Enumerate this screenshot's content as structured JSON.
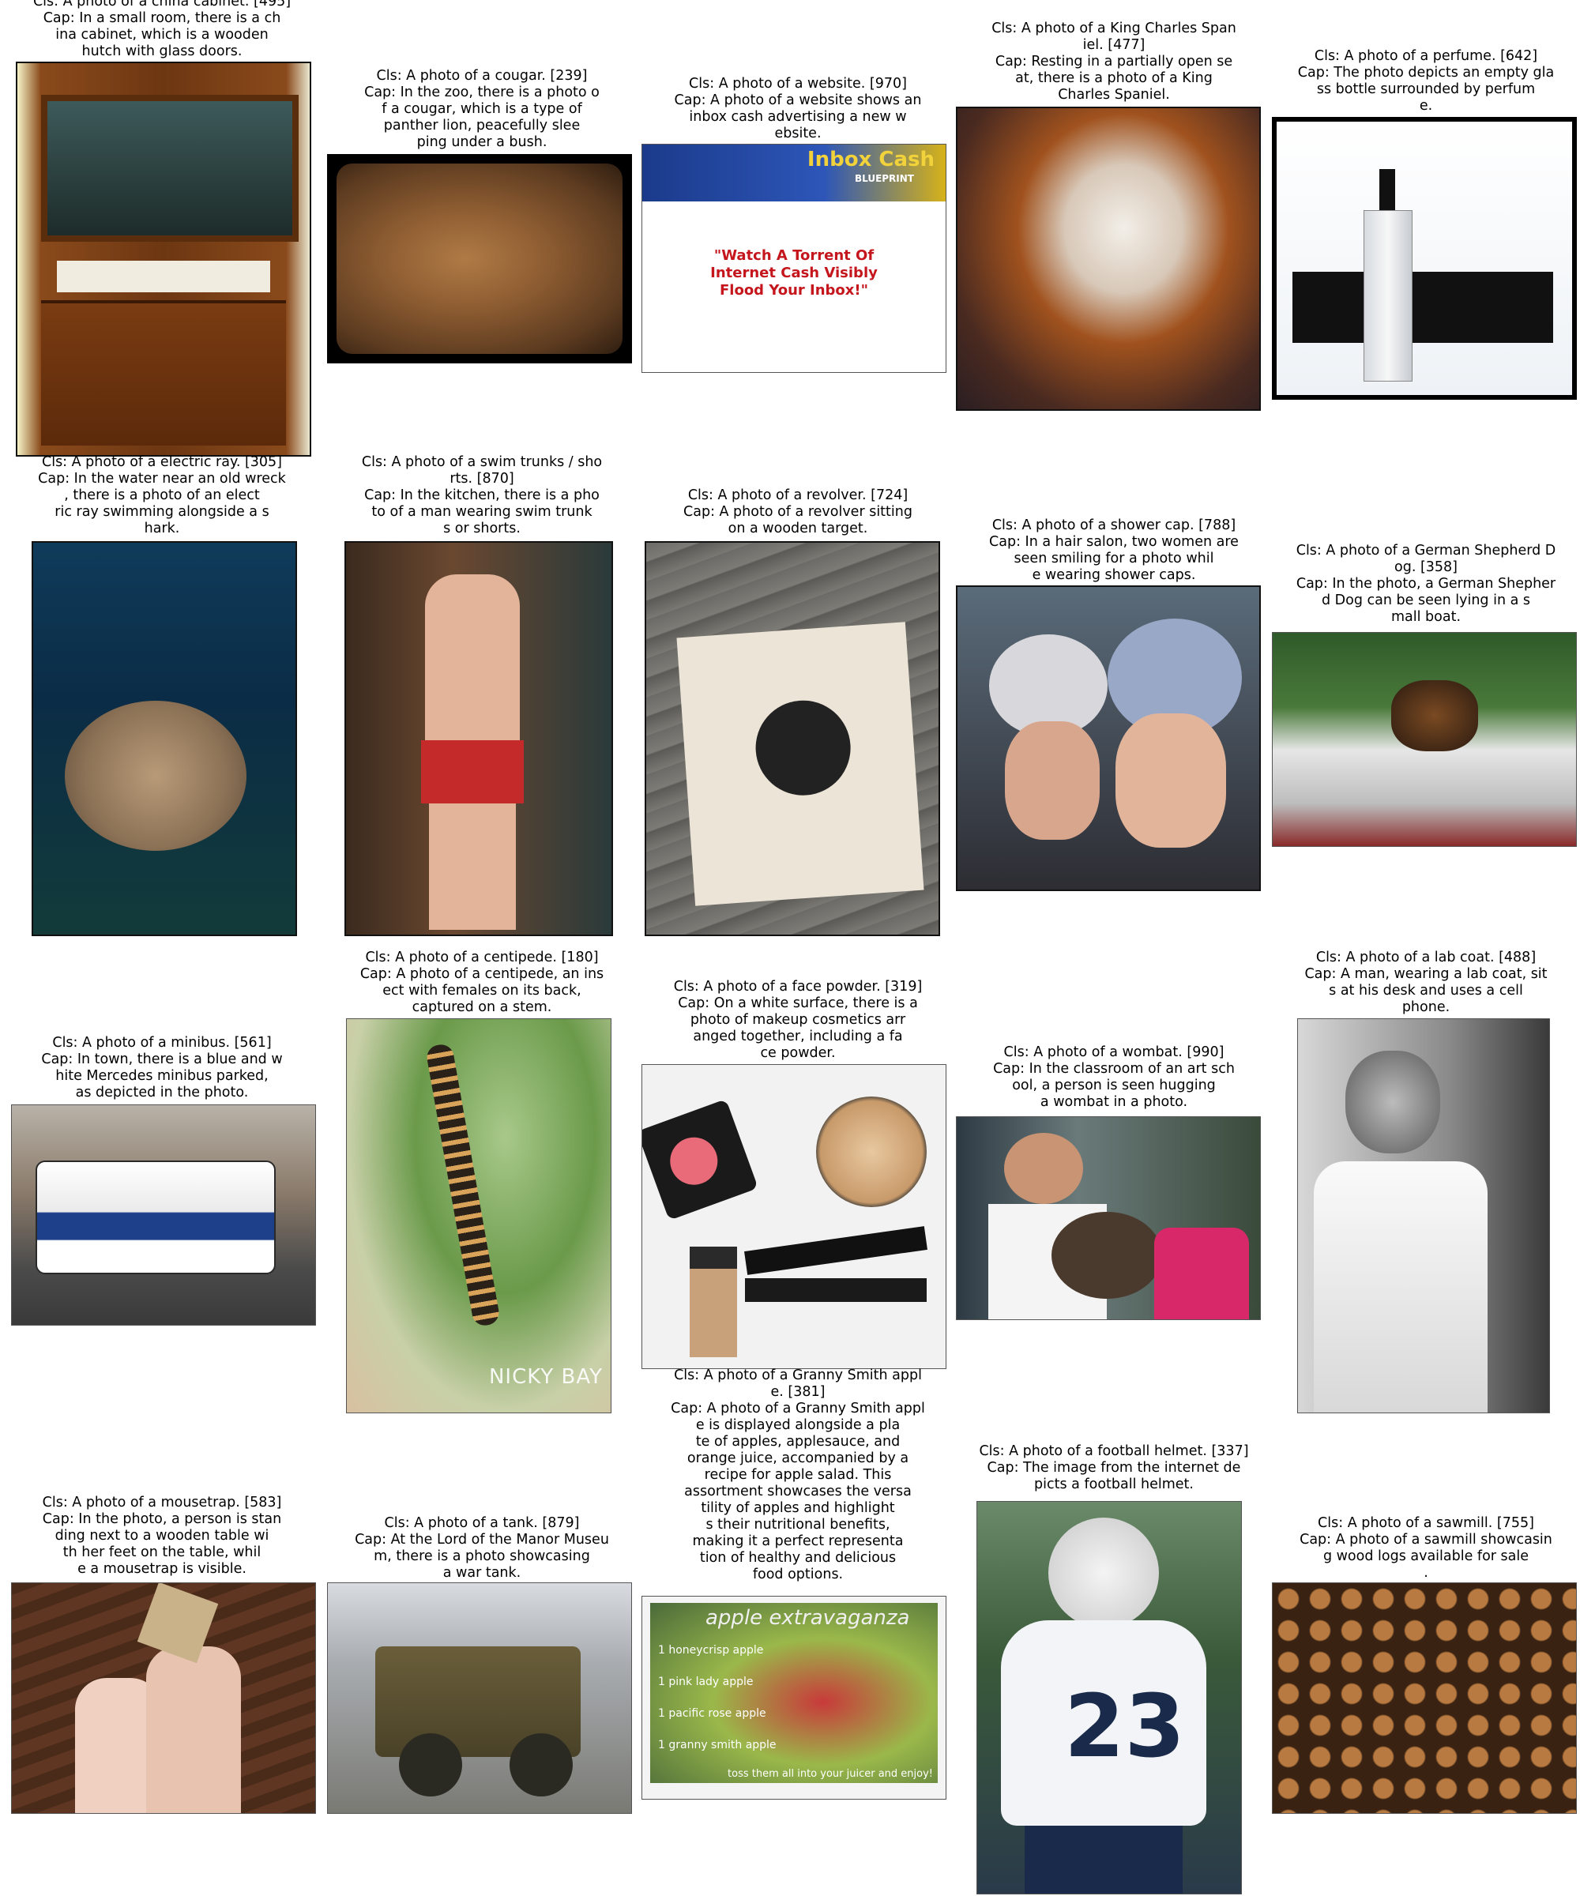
{
  "cells": [
    {
      "lines": [
        "Cls: A photo of a china cabinet. [495]",
        "Cap: In a small room, there is a ch",
        "ina cabinet, which is a wooden",
        "hutch with glass doors."
      ]
    },
    {
      "lines": [
        "Cls: A photo of a cougar. [239]",
        "Cap: In the zoo, there is a photo o",
        "f a cougar, which is a type of",
        "panther lion, peacefully slee",
        "ping under a bush."
      ]
    },
    {
      "lines": [
        "Cls: A photo of a website. [970]",
        "Cap: A photo of a website shows an",
        "inbox cash advertising a new w",
        "ebsite."
      ],
      "inner": {
        "banner": "Inbox Cash",
        "banner_sub": "BLUEPRINT",
        "headline": "\"Watch A Torrent Of Internet Cash Visibly Flood Your Inbox!\""
      }
    },
    {
      "lines": [
        "Cls: A photo of a King Charles Span",
        "iel. [477]",
        "Cap: Resting in a partially open se",
        "at, there is a photo of a King",
        "Charles Spaniel."
      ]
    },
    {
      "lines": [
        "Cls: A photo of a perfume. [642]",
        "Cap: The photo depicts an empty gla",
        "ss bottle surrounded by perfum",
        "e."
      ]
    },
    {
      "lines": [
        "Cls: A photo of a electric ray. [305]",
        "Cap: In the water near an old wreck",
        ", there is a photo of an elect",
        "ric ray swimming alongside a s",
        "hark."
      ]
    },
    {
      "lines": [
        "Cls: A photo of a swim trunks / sho",
        "rts. [870]",
        "Cap: In the kitchen, there is a pho",
        "to of a man wearing swim trunk",
        "s or shorts."
      ]
    },
    {
      "lines": [
        "Cls: A photo of a revolver. [724]",
        "Cap: A photo of a revolver sitting",
        "on a wooden target."
      ]
    },
    {
      "lines": [
        "Cls: A photo of a shower cap. [788]",
        "Cap: In a hair salon, two women are",
        "seen smiling for a photo whil",
        "e wearing shower caps."
      ]
    },
    {
      "lines": [
        "Cls: A photo of a German Shepherd D",
        "og. [358]",
        "Cap: In the photo, a German Shepher",
        "d Dog can be seen lying in a s",
        "mall boat."
      ]
    },
    {
      "lines": [
        "Cls: A photo of a minibus. [561]",
        "Cap: In town, there is a blue and w",
        "hite Mercedes minibus parked,",
        "as depicted in the photo."
      ]
    },
    {
      "lines": [
        "Cls: A photo of a centipede. [180]",
        "Cap: A photo of a centipede, an ins",
        "ect with females on its back,",
        "captured on a stem."
      ],
      "inner": {
        "watermark": "NICKY BAY"
      }
    },
    {
      "lines": [
        "Cls: A photo of a face powder. [319]",
        "Cap: On a white surface, there is a",
        "photo of makeup cosmetics arr",
        "anged together, including a fa",
        "ce powder."
      ]
    },
    {
      "lines": [
        "Cls: A photo of a wombat. [990]",
        "Cap: In the classroom of an art sch",
        "ool, a person is seen hugging",
        "a wombat in a photo."
      ]
    },
    {
      "lines": [
        "Cls: A photo of a lab coat. [488]",
        "Cap: A man, wearing a lab coat, sit",
        "s at his desk and uses a cell",
        "phone."
      ]
    },
    {
      "lines": [
        "Cls: A photo of a mousetrap. [583]",
        "Cap: In the photo, a person is stan",
        "ding next to a wooden table wi",
        "th her feet on the table, whil",
        "e a mousetrap is visible."
      ]
    },
    {
      "lines": [
        "Cls: A photo of a tank. [879]",
        "Cap: At the Lord of the Manor Museu",
        "m, there is a photo showcasing",
        "a war tank."
      ]
    },
    {
      "lines": [
        "Cls: A photo of a Granny Smith appl",
        "e. [381]",
        "Cap: A photo of a Granny Smith appl",
        "e is displayed alongside a pla",
        "te of apples, applesauce, and",
        "orange juice, accompanied by a",
        "recipe for apple salad. This",
        "assortment showcases the versa",
        "tility of apples and highlight",
        "s their nutritional benefits,",
        "making it a perfect representa",
        "tion of healthy and delicious",
        "food options."
      ],
      "inner": {
        "banner": "apple extravaganza",
        "list": [
          "1 honeycrisp apple",
          "1 pink lady apple",
          "1 pacific rose apple",
          "1 granny smith apple",
          "toss them all into your juicer and enjoy!"
        ]
      }
    },
    {
      "lines": [
        "Cls: A photo of a football helmet. [337]",
        "Cap: The image from the internet de",
        "picts a football helmet."
      ],
      "inner": {
        "jersey": "23"
      }
    },
    {
      "lines": [
        "Cls: A photo of a sawmill. [755]",
        "Cap: A photo of a sawmill showcasin",
        "g wood logs available for sale",
        "."
      ]
    }
  ]
}
